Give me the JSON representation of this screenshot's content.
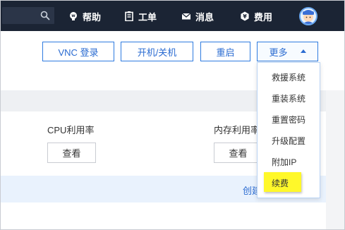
{
  "nav": {
    "help": "帮助",
    "tickets": "工单",
    "messages": "消息",
    "billing": "费用"
  },
  "toolbar": {
    "vnc_login": "VNC 登录",
    "power": "开机/关机",
    "restart": "重启",
    "more": "更多"
  },
  "metrics": {
    "cpu_label": "CPU利用率",
    "memory_label": "内存利用率",
    "view_label": "查看"
  },
  "create_link": "创建",
  "more_menu": {
    "items": [
      "救援系统",
      "重装系统",
      "重置密码",
      "升级配置",
      "附加IP",
      "续费"
    ],
    "highlighted_item": "续费",
    "highlight_color": "#fff82a"
  },
  "colors": {
    "nav_bg": "#1b2434",
    "accent": "#2e7be0"
  }
}
